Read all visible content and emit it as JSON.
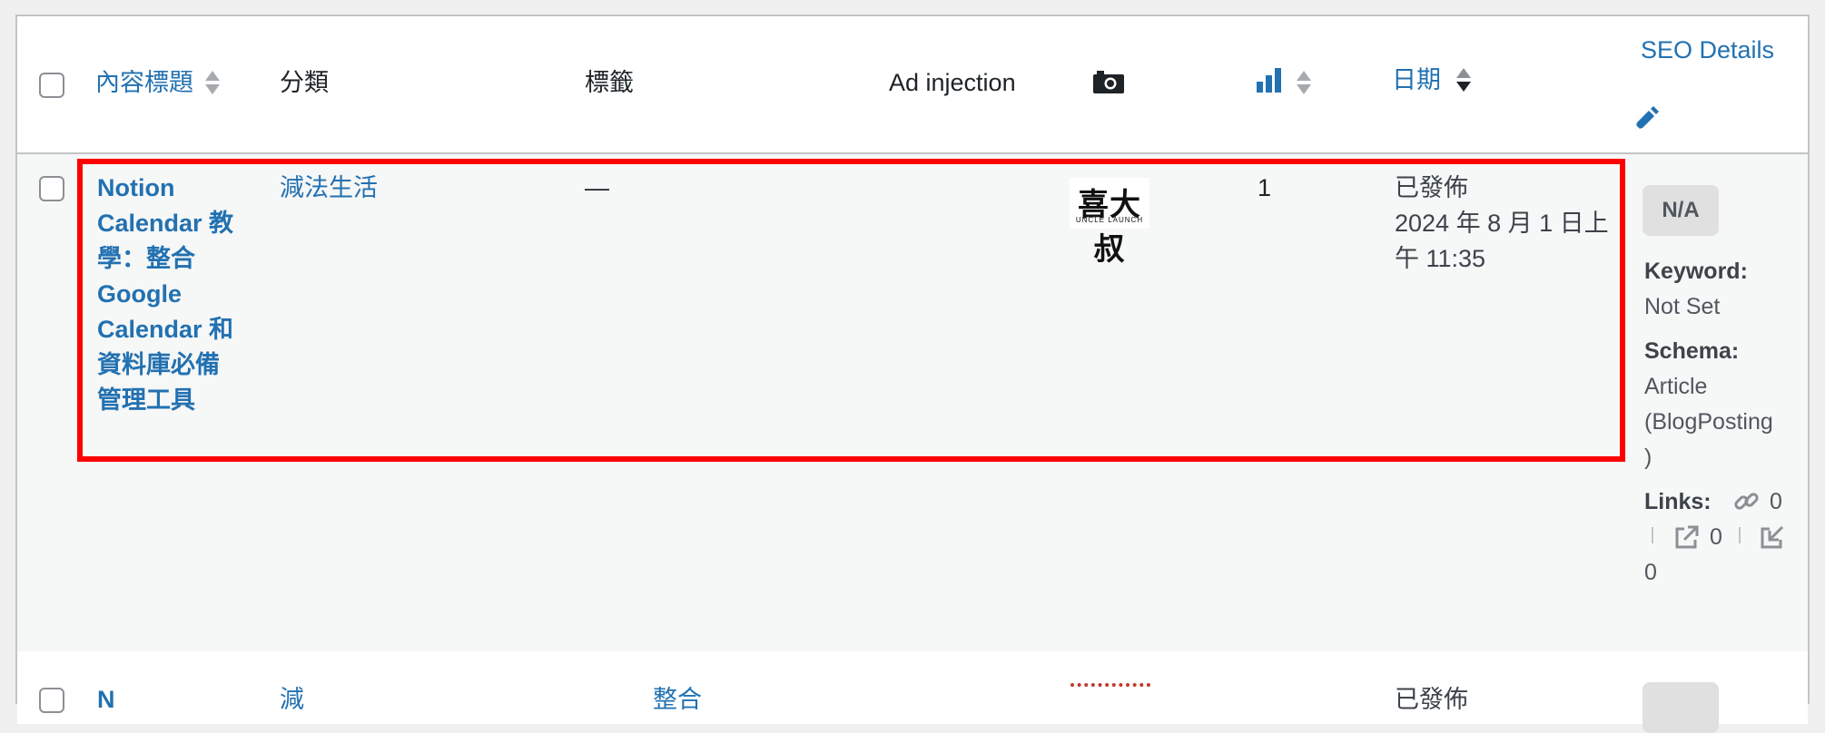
{
  "header": {
    "title_col": "內容標題",
    "category_col": "分類",
    "tags_col": "標籤",
    "ad_col": "Ad injection",
    "featured_image_icon": "camera-icon",
    "stats_icon": "bar-chart-icon",
    "date_col": "日期",
    "seo_col": "SEO Details",
    "seo_edit_icon": "pencil-icon"
  },
  "rows": [
    {
      "title_lines": [
        "Notion",
        "Calendar 教",
        "學：整合",
        "Google",
        "Calendar 和",
        "資料庫必備",
        "管理工具"
      ],
      "category": "減法生活",
      "tags": "—",
      "thumbnail_text": "喜大叔",
      "thumbnail_subtext": "UNCLE LAUNCH",
      "views": "1",
      "status": "已發佈",
      "date_lines": [
        "2024 年 8 月 1 日上",
        "午 11:35"
      ],
      "seo": {
        "score": "N/A",
        "keyword_label": "Keyword:",
        "keyword_value": "Not Set",
        "schema_label": "Schema:",
        "schema_lines": [
          "Article",
          "(BlogPosting",
          ")"
        ],
        "links_label": "Links:",
        "internal_links": "0",
        "external_links": "0",
        "incoming_links": "0"
      }
    },
    {
      "title_partial": "N",
      "category_partial": "減",
      "tags_partial": "整合",
      "status_partial": "已發佈"
    }
  ],
  "colors": {
    "link": "#2271b1",
    "highlight": "#ff0000",
    "row_bg": "#f6f7f7",
    "border": "#c3c4c7"
  }
}
